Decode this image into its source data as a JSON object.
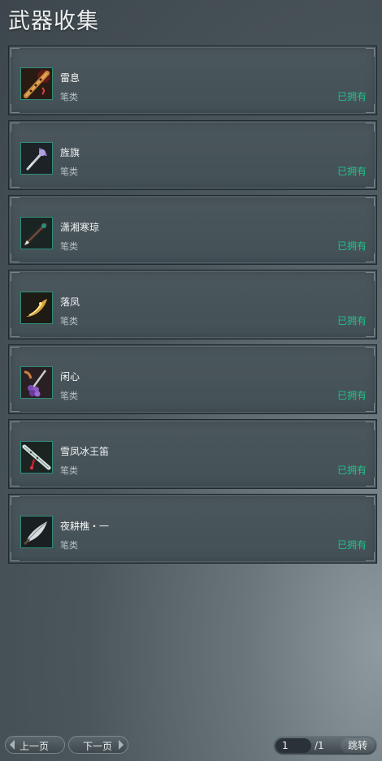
{
  "title": "武器收集",
  "items": [
    {
      "name": "雷息",
      "category": "笔类",
      "status": "已拥有",
      "icon": "flute-weapon-icon"
    },
    {
      "name": "旌旗",
      "category": "笔类",
      "status": "已拥有",
      "icon": "flag-brush-icon"
    },
    {
      "name": "潇湘寒琼",
      "category": "笔类",
      "status": "已拥有",
      "icon": "jade-brush-icon"
    },
    {
      "name": "落凤",
      "category": "笔类",
      "status": "已拥有",
      "icon": "phoenix-brush-icon"
    },
    {
      "name": "闲心",
      "category": "笔类",
      "status": "已拥有",
      "icon": "grape-brush-icon"
    },
    {
      "name": "雪凤冰王笛",
      "category": "笔类",
      "status": "已拥有",
      "icon": "ice-flute-icon"
    },
    {
      "name": "夜耕樵・一",
      "category": "笔类",
      "status": "已拥有",
      "icon": "leaf-blade-icon"
    }
  ],
  "pagination": {
    "prev_label": "上一页",
    "next_label": "下一页",
    "current_page": "1",
    "total": "/1",
    "jump_label": "跳转"
  },
  "colors": {
    "owned_status": "#22c08a",
    "icon_border": "#2e8d78"
  }
}
